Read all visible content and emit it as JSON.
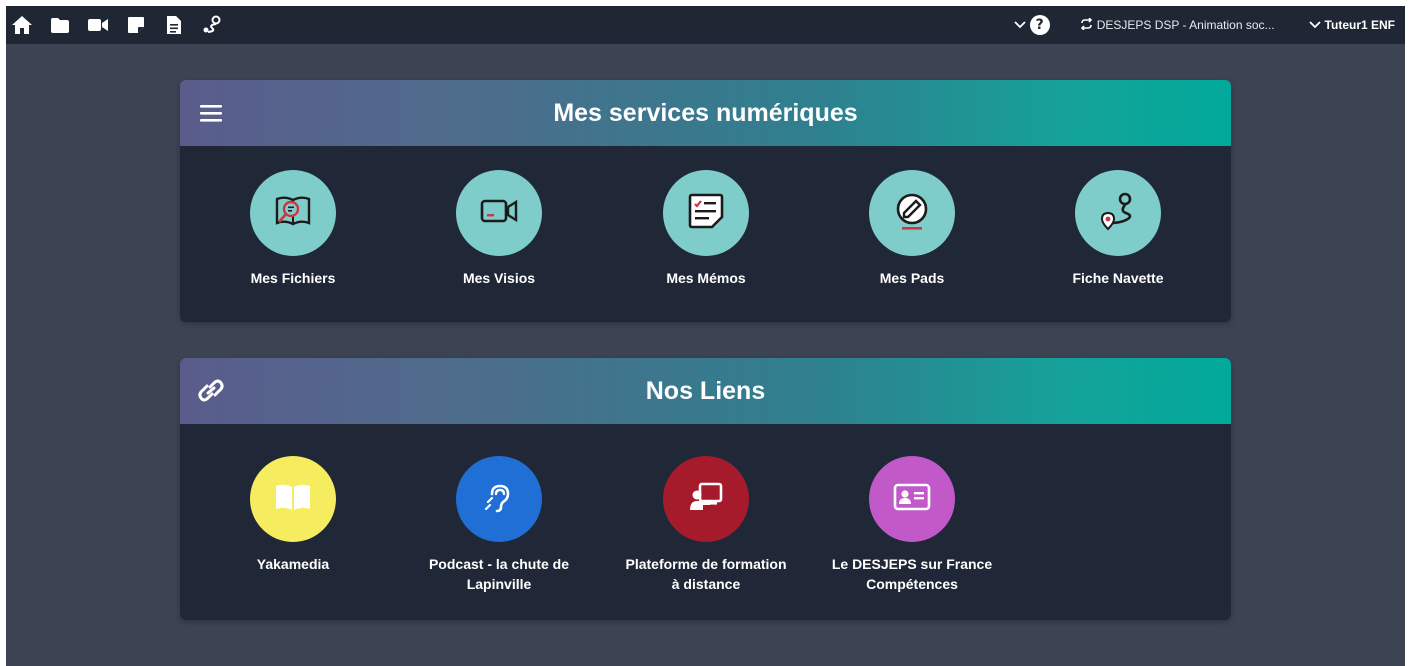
{
  "topbar": {
    "icons": [
      "home-icon",
      "folder-icon",
      "video-camera-icon",
      "sticky-note-icon",
      "document-icon",
      "route-icon"
    ],
    "help_icon": "question-circle-icon",
    "course_label": "DESJEPS DSP - Animation soc...",
    "user_label": "Tuteur1 ENF"
  },
  "services": {
    "title": "Mes services numériques",
    "menu_icon": "hamburger-menu-icon",
    "items": [
      {
        "label": "Mes Fichiers",
        "icon": "book-search-icon",
        "color": "#7fcdca"
      },
      {
        "label": "Mes Visios",
        "icon": "video-camera-icon",
        "color": "#7fcdca"
      },
      {
        "label": "Mes Mémos",
        "icon": "memo-list-icon",
        "color": "#7fcdca"
      },
      {
        "label": "Mes Pads",
        "icon": "pad-edit-icon",
        "color": "#7fcdca"
      },
      {
        "label": "Fiche Navette",
        "icon": "route-map-icon",
        "color": "#7fcdca"
      }
    ]
  },
  "links": {
    "title": "Nos Liens",
    "link_icon": "chain-link-icon",
    "items": [
      {
        "label": "Yakamedia",
        "icon": "open-book-icon",
        "color": "#f6ec5f"
      },
      {
        "label": "Podcast - la chute de Lapinville",
        "icon": "hearing-icon",
        "color": "#1f6fd6"
      },
      {
        "label": "Plateforme de formation à distance",
        "icon": "teacher-board-icon",
        "color": "#a51b2c"
      },
      {
        "label": "Le DESJEPS sur France Compétences",
        "icon": "id-card-icon",
        "color": "#c159c9"
      }
    ]
  },
  "colors": {
    "background": "#3c4353",
    "topbar": "#1f2634",
    "card": "#202838",
    "accent_teal": "#00a99a"
  }
}
